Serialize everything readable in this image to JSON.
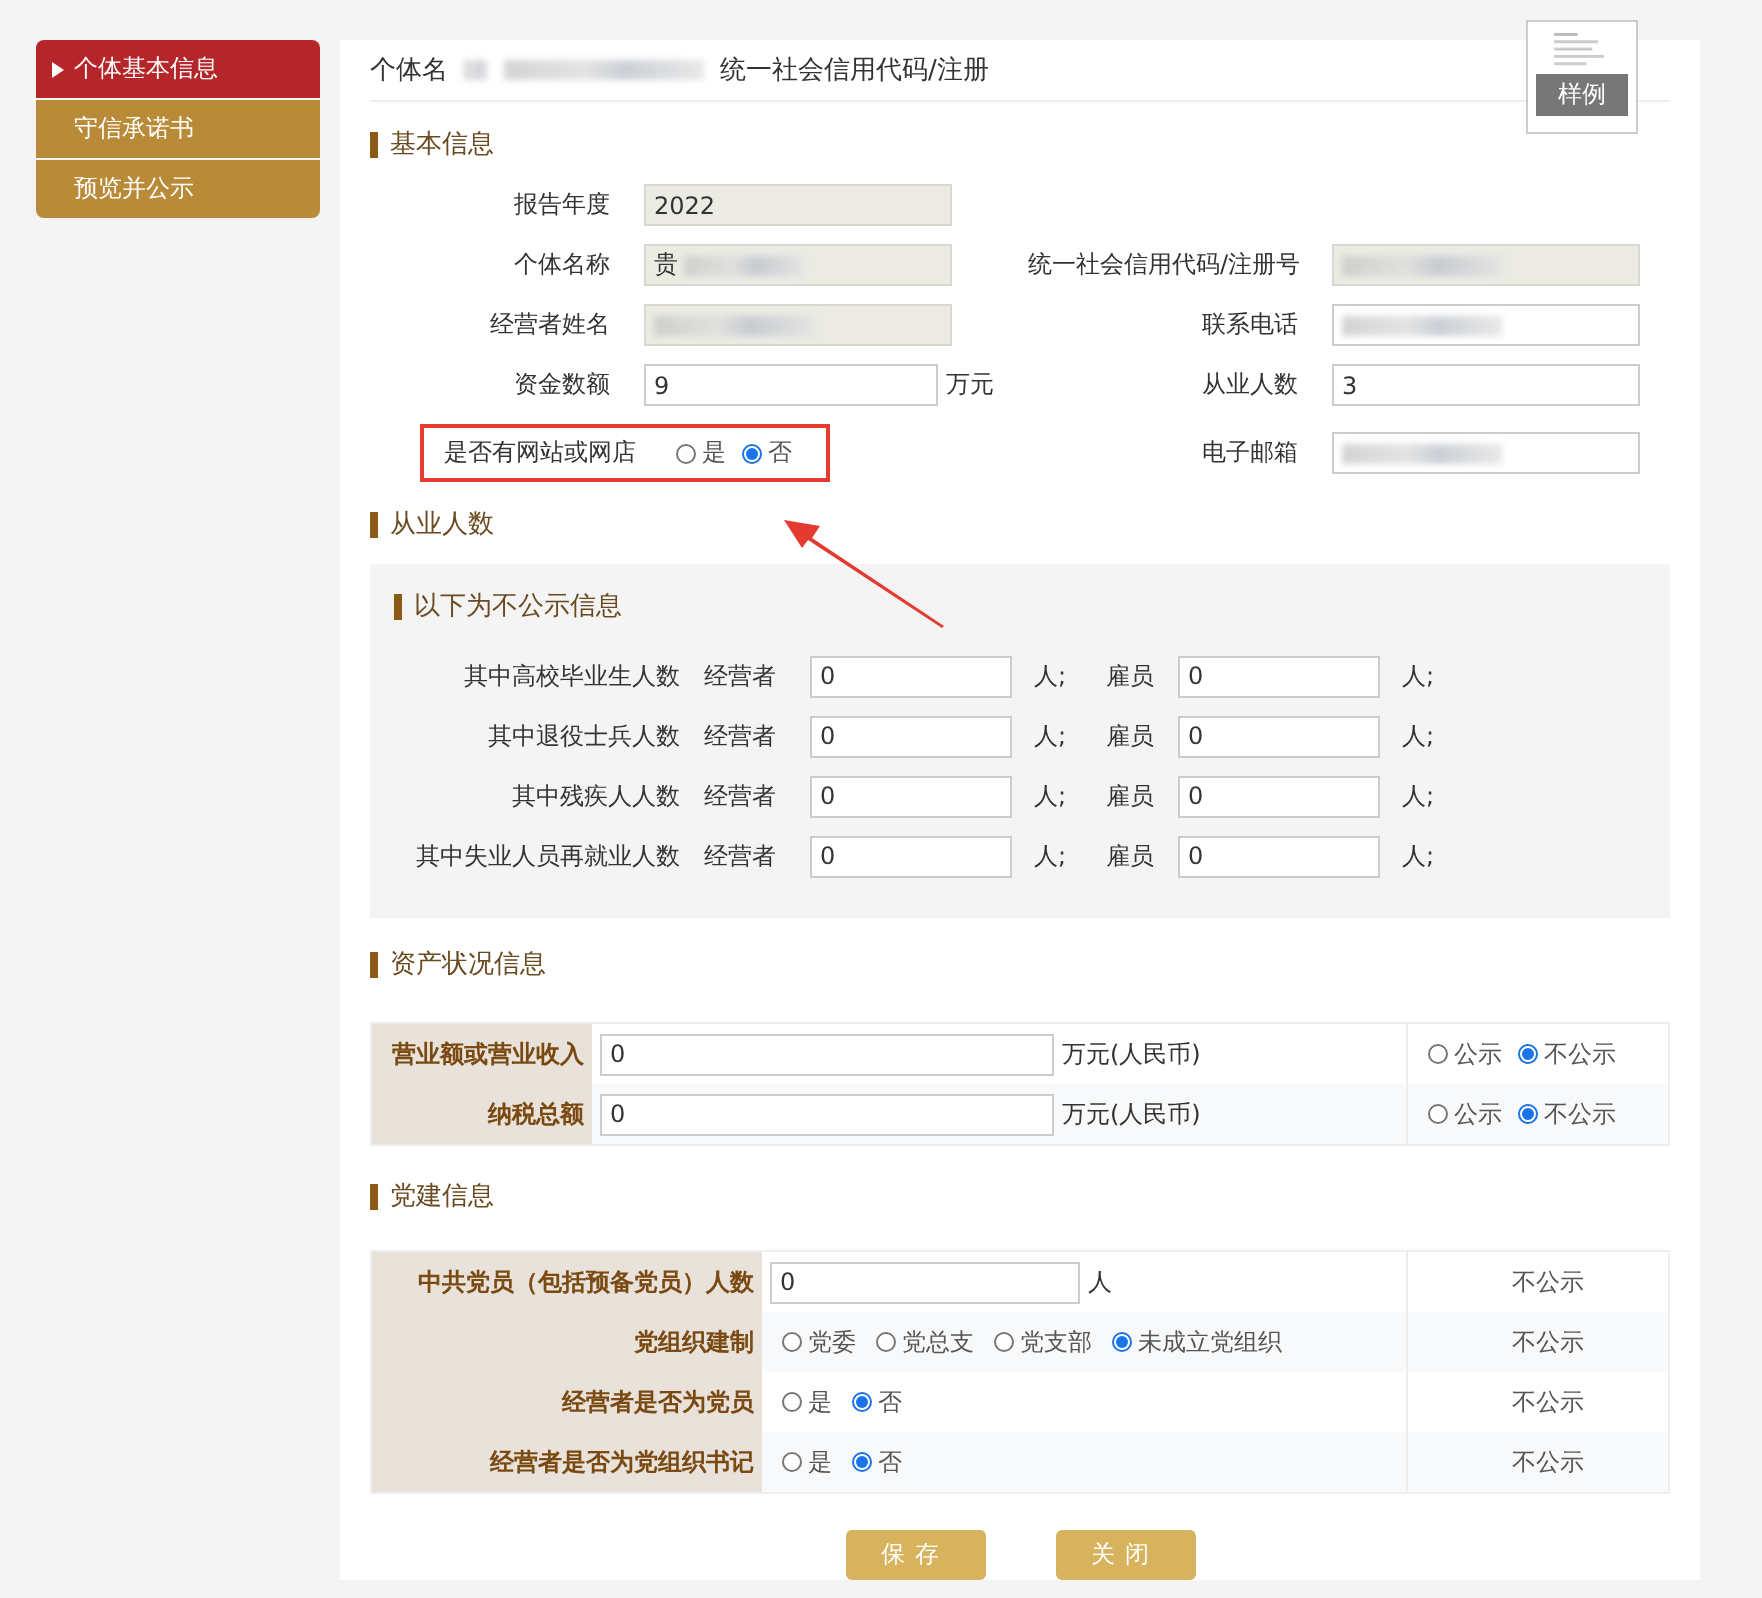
{
  "sidebar": {
    "items": [
      {
        "label": "个体基本信息",
        "selected": true
      },
      {
        "label": "守信承诺书",
        "selected": false
      },
      {
        "label": "预览并公示",
        "selected": false
      }
    ]
  },
  "header": {
    "fields": [
      {
        "label": "个体名"
      },
      {
        "label": "统一社会信用代码/注册"
      }
    ],
    "sample": {
      "label": "样例"
    }
  },
  "basic_info": {
    "title": "基本信息",
    "rows": [
      {
        "cells": [
          {
            "label": "报告年度",
            "kind": "readonly",
            "value": "2022"
          }
        ]
      },
      {
        "cells": [
          {
            "label": "个体名称",
            "kind": "readonly",
            "value": "贵",
            "redacted": true
          },
          {
            "label": "统一社会信用代码/注册号",
            "kind": "readonly",
            "redacted": true
          }
        ]
      },
      {
        "cells": [
          {
            "label": "经营者姓名",
            "kind": "readonly",
            "redacted": true
          },
          {
            "label": "联系电话",
            "kind": "input",
            "redacted": true
          }
        ]
      },
      {
        "cells": [
          {
            "label": "资金数额",
            "kind": "input",
            "value": "9",
            "unit": "万元"
          },
          {
            "label": "从业人数",
            "kind": "input",
            "value": "3"
          }
        ]
      },
      {
        "cells": [
          {
            "label": "是否有网站或网店",
            "kind": "radio",
            "highlighted": true,
            "options": [
              {
                "label": "是",
                "selected": false
              },
              {
                "label": "否",
                "selected": true
              }
            ]
          },
          {
            "label": "电子邮箱",
            "kind": "input",
            "redacted": true
          }
        ]
      }
    ]
  },
  "employment": {
    "title": "从业人数",
    "panel_title": "以下为不公示信息",
    "rows": [
      {
        "label": "其中高校毕业生人数",
        "owner_label": "经营者",
        "owner_value": "0",
        "owner_unit": "人;",
        "staff_label": "雇员",
        "staff_value": "0",
        "staff_unit": "人;"
      },
      {
        "label": "其中退役士兵人数",
        "owner_label": "经营者",
        "owner_value": "0",
        "owner_unit": "人;",
        "staff_label": "雇员",
        "staff_value": "0",
        "staff_unit": "人;"
      },
      {
        "label": "其中残疾人人数",
        "owner_label": "经营者",
        "owner_value": "0",
        "owner_unit": "人;",
        "staff_label": "雇员",
        "staff_value": "0",
        "staff_unit": "人;"
      },
      {
        "label": "其中失业人员再就业人数",
        "owner_label": "经营者",
        "owner_value": "0",
        "owner_unit": "人;",
        "staff_label": "雇员",
        "staff_value": "0",
        "staff_unit": "人;"
      }
    ]
  },
  "assets": {
    "title": "资产状况信息",
    "rows": [
      {
        "label": "营业额或营业收入",
        "value": "0",
        "unit": "万元(人民币)",
        "options": [
          {
            "label": "公示",
            "selected": false
          },
          {
            "label": "不公示",
            "selected": true
          }
        ]
      },
      {
        "label": "纳税总额",
        "value": "0",
        "unit": "万元(人民币)",
        "options": [
          {
            "label": "公示",
            "selected": false
          },
          {
            "label": "不公示",
            "selected": true
          }
        ]
      }
    ]
  },
  "party": {
    "title": "党建信息",
    "rows": [
      {
        "label": "中共党员（包括预备党员）人数",
        "kind": "input",
        "value": "0",
        "unit": "人",
        "visibility": "不公示"
      },
      {
        "label": "党组织建制",
        "kind": "radio",
        "options": [
          {
            "label": "党委",
            "selected": false
          },
          {
            "label": "党总支",
            "selected": false
          },
          {
            "label": "党支部",
            "selected": false
          },
          {
            "label": "未成立党组织",
            "selected": true
          }
        ],
        "visibility": "不公示"
      },
      {
        "label": "经营者是否为党员",
        "kind": "radio",
        "options": [
          {
            "label": "是",
            "selected": false
          },
          {
            "label": "否",
            "selected": true
          }
        ],
        "visibility": "不公示"
      },
      {
        "label": "经营者是否为党组织书记",
        "kind": "radio",
        "options": [
          {
            "label": "是",
            "selected": false
          },
          {
            "label": "否",
            "selected": true
          }
        ],
        "visibility": "不公示"
      }
    ]
  },
  "buttons": [
    "保存",
    "关闭"
  ]
}
